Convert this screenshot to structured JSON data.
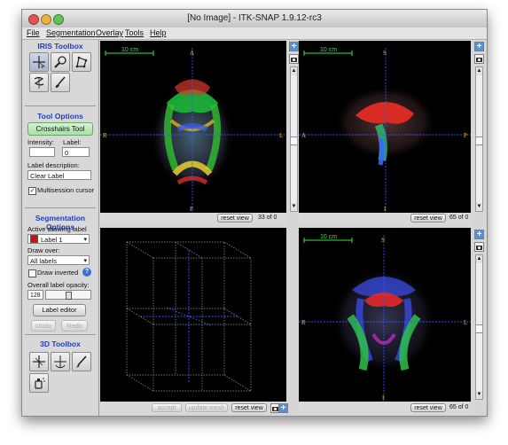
{
  "window": {
    "title": "[No Image] - ITK-SNAP 1.9.12-rc3"
  },
  "menu": [
    "File",
    "Segmentation",
    "Overlay",
    "Tools",
    "Help"
  ],
  "iris_toolbox": {
    "title": "IRIS Toolbox",
    "tools": [
      "crosshairs-icon",
      "zoom-icon",
      "polygon-icon",
      "snake-icon",
      "paintbrush-icon"
    ],
    "active_tool": "crosshairs-icon"
  },
  "tool_options": {
    "title": "Tool Options",
    "active_tool_label": "Crosshairs Tool",
    "intensity_label": "Intensity:",
    "intensity_value": "",
    "label_label": "Label:",
    "label_value": "0",
    "label_description_label": "Label description:",
    "label_description_value": "Clear Label",
    "multisession_cursor_label": "Multisession cursor",
    "multisession_cursor_checked": true
  },
  "segmentation_options": {
    "title": "Segmentation Options",
    "active_label_title": "Active drawing label",
    "active_label_value": "Label 1",
    "active_label_color": "#cc1111",
    "draw_over_title": "Draw over:",
    "draw_over_value": "All labels",
    "draw_inverted_label": "Draw inverted",
    "draw_inverted_checked": false,
    "help_label": "?",
    "opacity_title": "Overall label opacity:",
    "opacity_value": "128",
    "opacity_fraction": 0.5,
    "label_editor_label": "Label editor",
    "undo_label": "Undo",
    "redo_label": "Redo"
  },
  "toolbox_3d": {
    "title": "3D Toolbox",
    "tools": [
      "crosshairs-3d-icon",
      "rotate-3d-icon",
      "scalpel-icon",
      "spraypaint-icon"
    ]
  },
  "views": {
    "axial": {
      "scale_label": "10 cm",
      "orient_top": "A",
      "orient_bottom": "P",
      "orient_left": "R",
      "orient_right": "L",
      "reset_label": "reset view",
      "slice_text": "33 of 0"
    },
    "sagittal": {
      "scale_label": "10 cm",
      "orient_top": "S",
      "orient_bottom": "I",
      "orient_left": "A",
      "orient_right": "P",
      "reset_label": "reset view",
      "slice_text": "65 of 0"
    },
    "coronal": {
      "scale_label": "10 cm",
      "orient_top": "S",
      "orient_bottom": "I",
      "orient_left": "R",
      "orient_right": "L",
      "reset_label": "reset view",
      "slice_text": "65 of 0"
    },
    "three_d": {
      "accept_label": "accept",
      "update_mesh_label": "update mesh",
      "reset_label": "reset view"
    }
  },
  "colors": {
    "crosshair": "#3355ff",
    "orientation_labels": "#f2c200",
    "scale_bar": "#39e63a",
    "section_title": "#1e3ec8"
  }
}
